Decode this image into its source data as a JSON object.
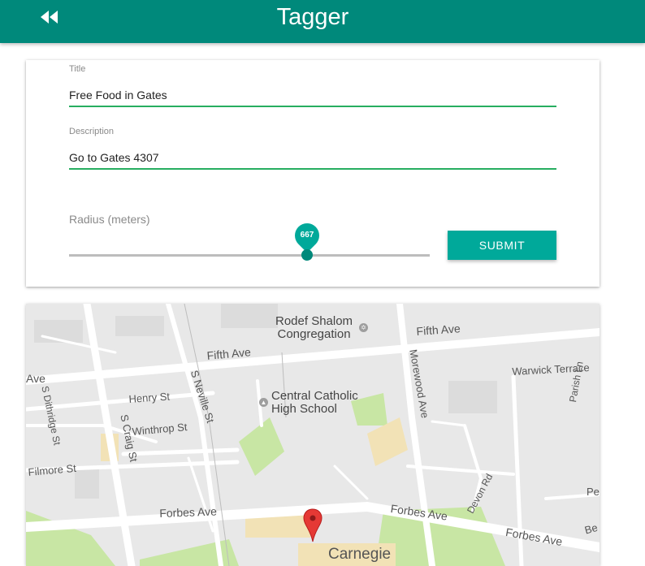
{
  "appbar": {
    "title": "Tagger",
    "back_icon": "fast-rewind-icon"
  },
  "form": {
    "title_label": "Title",
    "title_value": "Free Food in Gates",
    "description_label": "Description",
    "description_value": "Go to Gates 4307",
    "radius_label": "Radius (meters)",
    "radius_value": "667",
    "radius_fraction": 0.66,
    "submit_label": "SUBMIT"
  },
  "map": {
    "labels": {
      "rodef_shalom": "Rodef Shalom\nCongregation",
      "fifth_ave_right": "Fifth Ave",
      "fifth_ave_left": "Fifth Ave",
      "ave_edge": "Ave",
      "warwick_terrace": "Warwick Terrace",
      "henry_st": "Henry St",
      "s_neville_st": "S Neville St",
      "central_catholic": "Central Catholic\nHigh School",
      "morewood_ave": "Morewood Ave",
      "s_dithridge_st": "S Dithridge St",
      "s_craig_st": "S Craig St",
      "winthrop_st": "Winthrop St",
      "parish_ln": "Parish Ln",
      "filmore_st": "Filmore St",
      "devon_rd": "Devon Rd",
      "pe_edge": "Pe",
      "forbes_ave_left": "Forbes Ave",
      "forbes_ave_mid": "Forbes Ave",
      "forbes_ave_right": "Forbes Ave",
      "be_edge": "Be",
      "carnegie": "Carnegie"
    }
  },
  "colors": {
    "appbar": "#00897b",
    "accent": "#00a99a",
    "input_underline": "#27ae60",
    "marker": "#e53935"
  }
}
